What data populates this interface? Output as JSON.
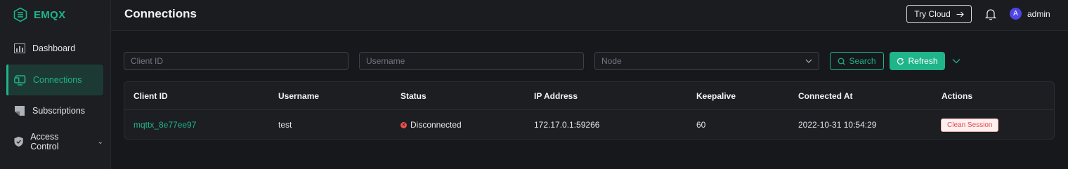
{
  "app": {
    "name": "EMQX"
  },
  "sidebar": {
    "items": [
      {
        "label": "Dashboard",
        "icon": "dashboard-icon",
        "active": false
      },
      {
        "label": "Connections",
        "icon": "connections-icon",
        "active": true
      },
      {
        "label": "Subscriptions",
        "icon": "subscriptions-icon",
        "active": false
      },
      {
        "label": "Access Control",
        "icon": "shield-icon",
        "active": false
      }
    ]
  },
  "header": {
    "title": "Connections",
    "try_cloud_label": "Try Cloud",
    "user_initial": "A",
    "user_name": "admin"
  },
  "filters": {
    "client_id_placeholder": "Client ID",
    "username_placeholder": "Username",
    "node_placeholder": "Node",
    "search_label": "Search",
    "refresh_label": "Refresh"
  },
  "table": {
    "columns": [
      "Client ID",
      "Username",
      "Status",
      "IP Address",
      "Keepalive",
      "Connected At",
      "Actions"
    ],
    "rows": [
      {
        "client_id": "mqttx_8e77ee97",
        "username": "test",
        "status": "Disconnected",
        "ip_address": "172.17.0.1:59266",
        "keepalive": "60",
        "connected_at": "2022-10-31 10:54:29",
        "action": "Clean Session"
      }
    ]
  },
  "colors": {
    "accent": "#1fb48a",
    "background": "#16181c",
    "status_disconnected": "#ee4d4d"
  }
}
